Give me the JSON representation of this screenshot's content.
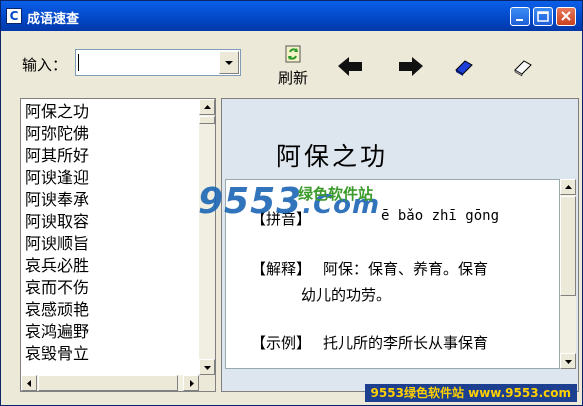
{
  "window": {
    "title": "成语速查",
    "app_icon_letter": "C"
  },
  "toolbar": {
    "input_label": "输入：",
    "input_value": "",
    "refresh_label": "刷新"
  },
  "list": {
    "items": [
      "阿保之功",
      "阿弥陀佛",
      "阿其所好",
      "阿谀逢迎",
      "阿谀奉承",
      "阿谀取容",
      "阿谀顺旨",
      "哀兵必胜",
      "哀而不伤",
      "哀感顽艳",
      "哀鸿遍野",
      "哀毁骨立"
    ]
  },
  "detail": {
    "headword": "阿保之功",
    "pinyin_tag": "【拼音】",
    "pinyin": "ē bǎo zhī gōng",
    "explain_tag": "【解释】",
    "explain_line1": "阿保：保育、养育。保育",
    "explain_line2": "幼儿的功劳。",
    "example_tag": "【示例】",
    "example_line1": "托儿所的李所长从事保育"
  },
  "watermark": {
    "main": "9553",
    "sub": "绿色软件站",
    "dotcom": ".Com",
    "bottom": "9553绿色软件站 www.9553.com"
  },
  "icons": [
    "refresh-icon",
    "back-arrow-icon",
    "forward-arrow-icon",
    "blue-eraser-icon",
    "white-eraser-icon"
  ]
}
